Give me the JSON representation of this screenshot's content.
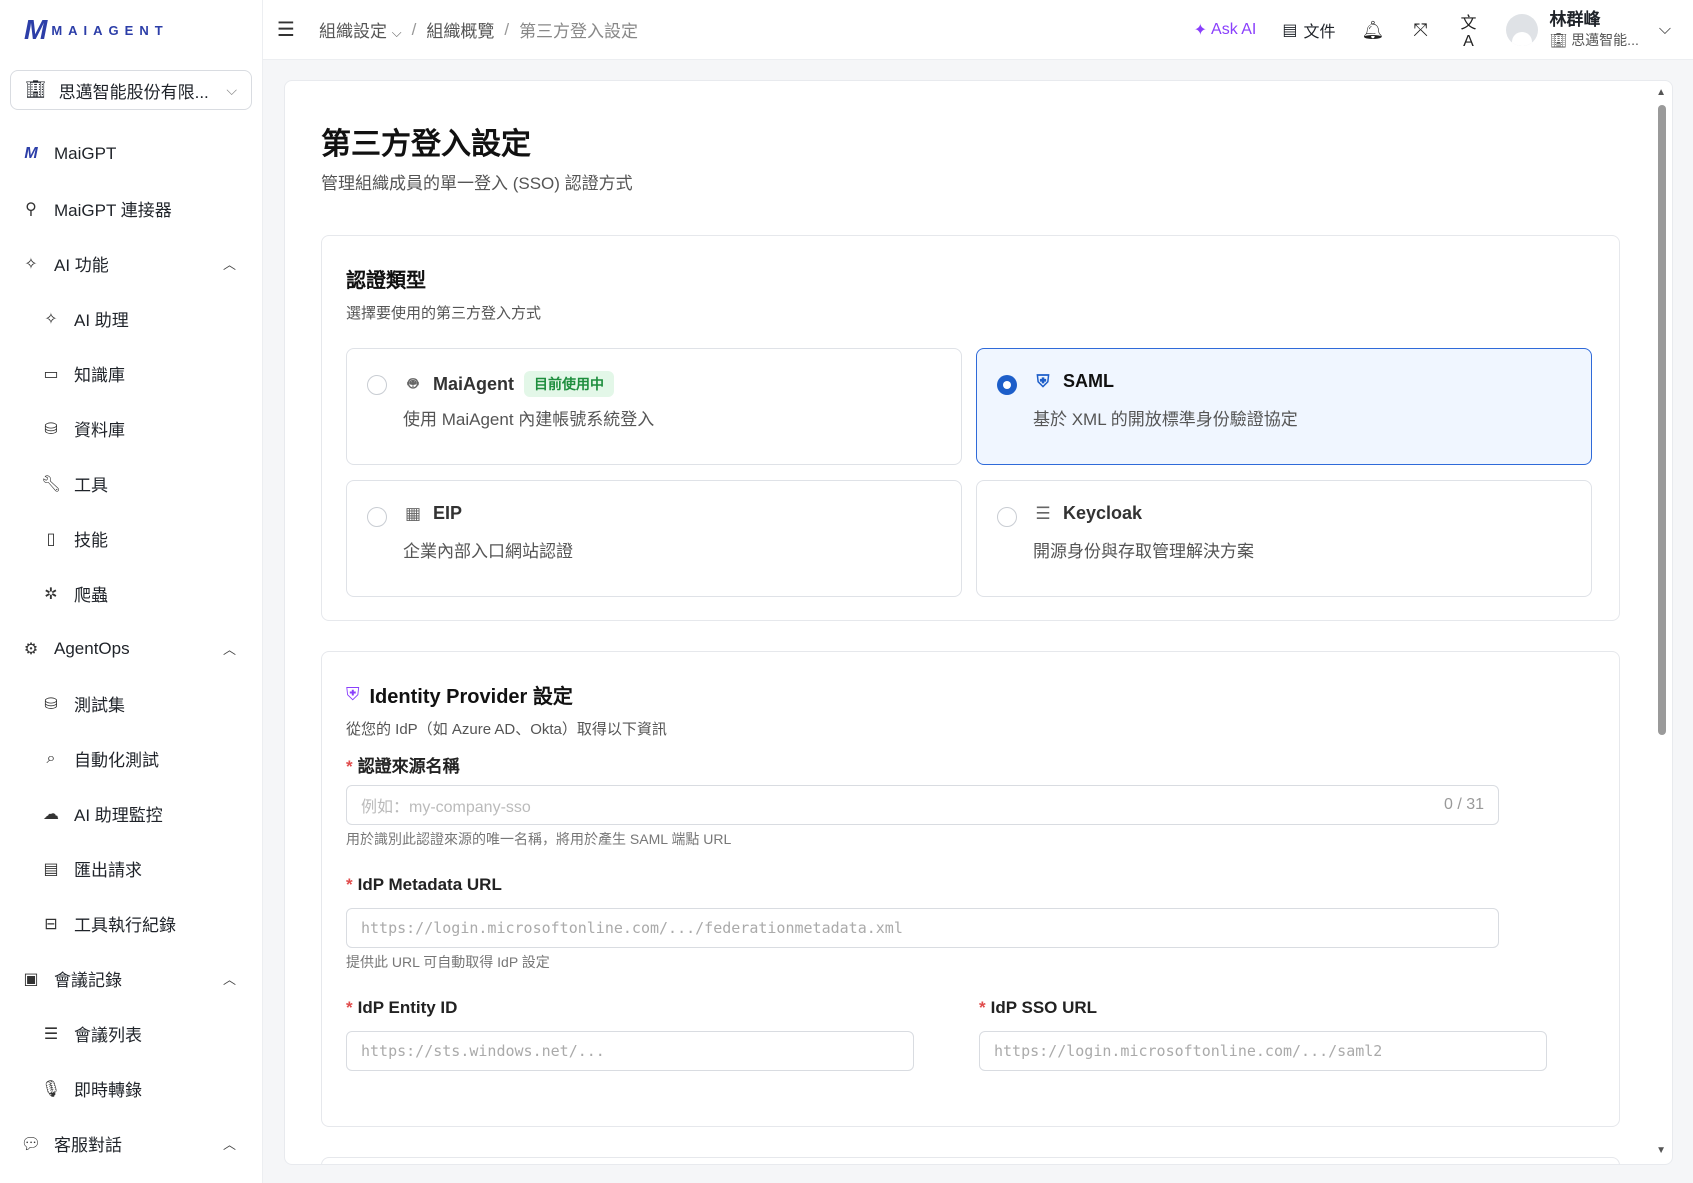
{
  "brand": {
    "logo_mark": "M",
    "logo_text": "MAIAGENT"
  },
  "sidebar": {
    "org": "思邁智能股份有限...",
    "items": [
      {
        "label": "MaiGPT",
        "icon": "maigpt-logo-icon"
      },
      {
        "label": "MaiGPT 連接器",
        "icon": "connector-icon"
      },
      {
        "label": "AI 功能",
        "icon": "sparkle-icon"
      },
      {
        "label": "AI 助理",
        "icon": "sparkle-icon"
      },
      {
        "label": "知識庫",
        "icon": "book-icon"
      },
      {
        "label": "資料庫",
        "icon": "database-icon"
      },
      {
        "label": "工具",
        "icon": "wrench-icon"
      },
      {
        "label": "技能",
        "icon": "skill-file-icon"
      },
      {
        "label": "爬蟲",
        "icon": "bug-icon"
      },
      {
        "label": "AgentOps",
        "icon": "agentops-icon"
      },
      {
        "label": "測試集",
        "icon": "database-icon"
      },
      {
        "label": "自動化測試",
        "icon": "search-test-icon"
      },
      {
        "label": "AI 助理監控",
        "icon": "cloud-monitor-icon"
      },
      {
        "label": "匯出請求",
        "icon": "export-file-icon"
      },
      {
        "label": "工具執行紀錄",
        "icon": "toolbox-icon"
      },
      {
        "label": "會議記錄",
        "icon": "meeting-icon"
      },
      {
        "label": "會議列表",
        "icon": "list-icon"
      },
      {
        "label": "即時轉錄",
        "icon": "microphone-icon"
      },
      {
        "label": "客服對話",
        "icon": "chat-icon"
      }
    ]
  },
  "header": {
    "breadcrumb": [
      "組織設定",
      "組織概覽",
      "第三方登入設定"
    ],
    "ask_ai": "Ask AI",
    "docs": "文件",
    "user_name": "林群峰",
    "user_org": "思邁智能..."
  },
  "page": {
    "title": "第三方登入設定",
    "description": "管理組織成員的單一登入 (SSO) 認證方式"
  },
  "auth_card": {
    "title": "認證類型",
    "description": "選擇要使用的第三方登入方式",
    "options": [
      {
        "name": "MaiAgent",
        "badge": "目前使用中",
        "description": "使用 MaiAgent 內建帳號系統登入",
        "icon": "robot-icon",
        "selected": false
      },
      {
        "name": "SAML",
        "badge": "",
        "description": "基於 XML 的開放標準身份驗證協定",
        "icon": "shield-check-icon",
        "selected": true
      },
      {
        "name": "EIP",
        "badge": "",
        "description": "企業內部入口網站認證",
        "icon": "building-icon",
        "selected": false
      },
      {
        "name": "Keycloak",
        "badge": "",
        "description": "開源身份與存取管理解決方案",
        "icon": "server-icon",
        "selected": false
      }
    ]
  },
  "idp_card": {
    "title": "Identity Provider 設定",
    "description": "從您的 IdP（如 Azure AD、Okta）取得以下資訊",
    "fields": {
      "source_name": {
        "label": "認證來源名稱",
        "placeholder": "例如：my-company-sso",
        "counter": "0 / 31",
        "help": "用於識別此認證來源的唯一名稱，將用於產生 SAML 端點 URL"
      },
      "metadata_url": {
        "label": "IdP Metadata URL",
        "placeholder": "https://login.microsoftonline.com/.../federationmetadata.xml",
        "help": "提供此 URL 可自動取得 IdP 設定"
      },
      "entity_id": {
        "label": "IdP Entity ID",
        "placeholder": "https://sts.windows.net/..."
      },
      "sso_url": {
        "label": "IdP SSO URL",
        "placeholder": "https://login.microsoftonline.com/.../saml2"
      }
    },
    "required_mark": "*"
  },
  "colors": {
    "accent": "#1d5ec9",
    "ask_ai": "#8a3ffc",
    "badge_green": "#1e8e3e",
    "required": "#e04b4b"
  }
}
